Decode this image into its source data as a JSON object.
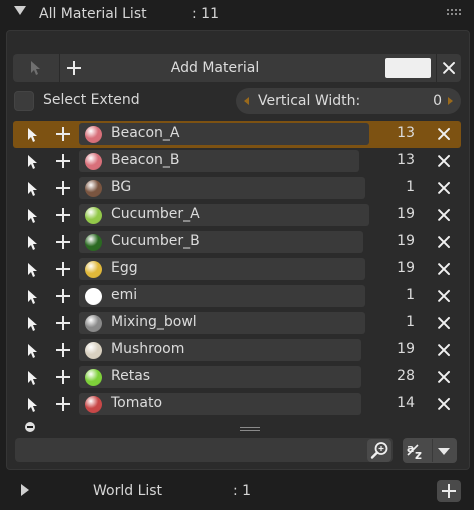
{
  "header": {
    "title": "All Material List",
    "count": ": 11"
  },
  "toolbar": {
    "add_label": "Add Material",
    "swatch_color": "#efefef"
  },
  "options": {
    "select_extend_label": "Select Extend",
    "select_extend_checked": false,
    "vertical_width_label": "Vertical Width:",
    "vertical_width_value": "0"
  },
  "colors": {
    "selected_row": "#7d5212",
    "accent_arrow": "#9a6a1c",
    "panel_bg": "#2b2b2b"
  },
  "materials": [
    {
      "name": "Beacon_A",
      "count": "13",
      "color": "#d8707a",
      "selected": true
    },
    {
      "name": "Beacon_B",
      "count": "13",
      "color": "#d8707a",
      "selected": false
    },
    {
      "name": "BG",
      "count": "1",
      "color": "#7a5540",
      "selected": false
    },
    {
      "name": "Cucumber_A",
      "count": "19",
      "color": "#93c94a",
      "selected": false
    },
    {
      "name": "Cucumber_B",
      "count": "19",
      "color": "#2b6a22",
      "selected": false
    },
    {
      "name": "Egg",
      "count": "19",
      "color": "#e0b83a",
      "selected": false
    },
    {
      "name": "emi",
      "count": "1",
      "color": "#ffffff",
      "selected": false
    },
    {
      "name": "Mixing_bowl",
      "count": "1",
      "color": "#8a8a8a",
      "selected": false
    },
    {
      "name": "Mushroom",
      "count": "19",
      "color": "#d8d0c0",
      "selected": false
    },
    {
      "name": "Retas",
      "count": "28",
      "color": "#7ed03a",
      "selected": false
    },
    {
      "name": "Tomato",
      "count": "14",
      "color": "#c84848",
      "selected": false
    }
  ],
  "footer": {
    "world_label": "World List",
    "world_count": ": 1"
  },
  "icons": [
    "triangle-down-icon",
    "cursor-icon",
    "plus-icon",
    "close-icon",
    "minus-icon",
    "search-icon",
    "sort-alpha-icon",
    "chevron-down-icon",
    "triangle-right-icon"
  ]
}
